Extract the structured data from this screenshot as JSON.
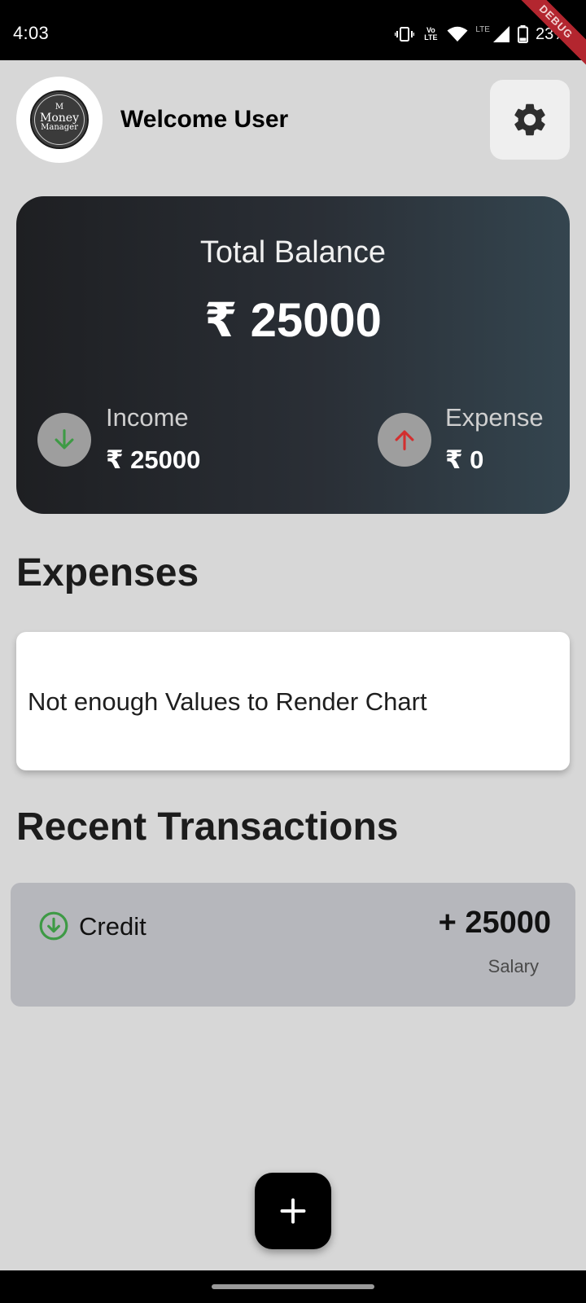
{
  "status_bar": {
    "time": "4:03",
    "volte_line1": "Vo",
    "volte_line2": "LTE",
    "lte": "LTE",
    "battery": "23%",
    "debug_banner": "DEBUG",
    "icons": [
      "vibrate-icon",
      "volte-icon",
      "wifi-icon",
      "signal-icon",
      "battery-icon"
    ]
  },
  "header": {
    "logo": {
      "top": "M",
      "line1": "Money",
      "line2": "Manager"
    },
    "welcome": "Welcome User",
    "settings_icon": "gear-icon"
  },
  "balance": {
    "title": "Total Balance",
    "amount": "₹ 25000",
    "income": {
      "label": "Income",
      "value": "₹ 25000",
      "icon": "arrow-down-icon",
      "color": "#3e9a45"
    },
    "expense": {
      "label": "Expense",
      "value": "₹ 0",
      "icon": "arrow-up-icon",
      "color": "#d32f2f"
    }
  },
  "expenses": {
    "heading": "Expenses",
    "chart_message": "Not enough Values to Render Chart"
  },
  "recent": {
    "heading": "Recent Transactions",
    "transactions": [
      {
        "type": "Credit",
        "amount": "+ 25000",
        "category": "Salary",
        "icon": "arrow-circle-down-icon",
        "color": "#3e9a45"
      }
    ]
  },
  "fab": {
    "icon": "plus-icon"
  },
  "colors": {
    "background": "#d7d7d7",
    "card_gradient_start": "#1e1f22",
    "card_gradient_end": "#34454f",
    "transaction_card": "#b6b7bc"
  }
}
